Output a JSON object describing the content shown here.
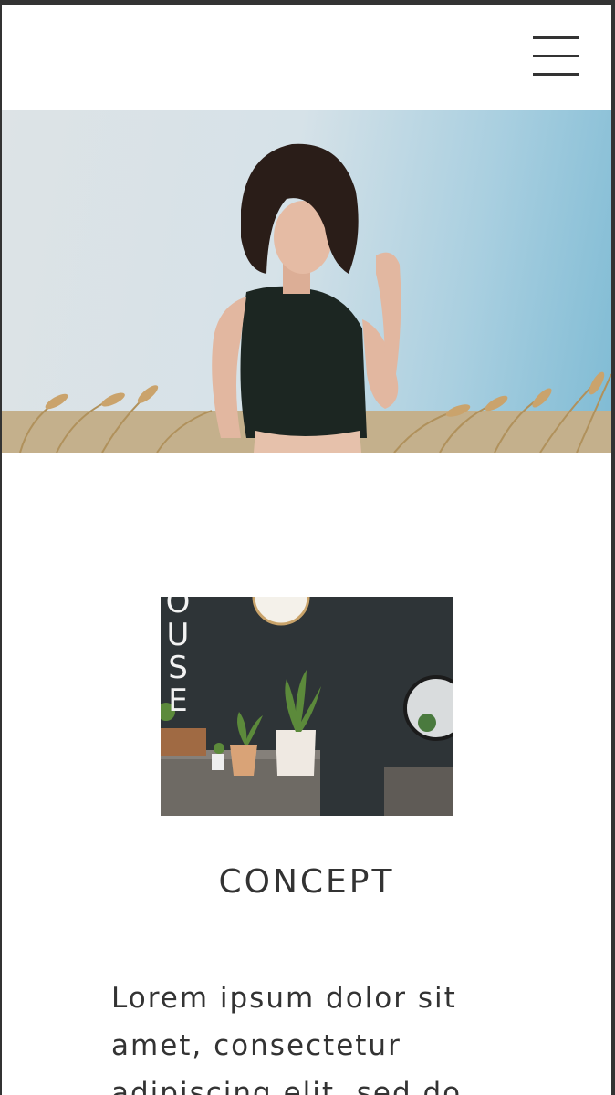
{
  "header": {
    "menu_icon": "hamburger-menu-icon"
  },
  "hero": {
    "image_subject": "woman standing in a wheat field under a blue sky"
  },
  "concept": {
    "image_subject": "salon interior with potted plants and a round mirror",
    "image_wall_letters": [
      "O",
      "U",
      "S",
      "E"
    ],
    "title": "CONCEPT",
    "body": "Lorem ipsum dolor sit amet, consectetur adipiscing elit, sed do"
  },
  "colors": {
    "text": "#333333",
    "background": "#ffffff",
    "hero_sky": "#7fbbd4"
  }
}
